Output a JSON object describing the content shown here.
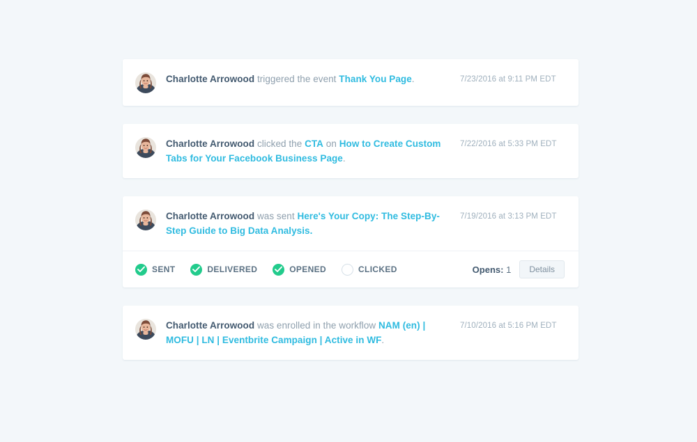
{
  "theme": {
    "page_background": "#f3f7fa",
    "card_background": "#ffffff",
    "name_color": "#42596f",
    "body_text_color": "#8e9fad",
    "link_color": "#2fbbe0",
    "timestamp_color": "#9fb0bd",
    "success_color": "#22cb8c",
    "empty_bullet_border": "#d6e0e8"
  },
  "avatar": {
    "alt": "Charlotte Arrowood profile photo",
    "icon": "user-avatar-photo"
  },
  "events": [
    {
      "id": "event-thank-you-page",
      "actor": "Charlotte Arrowood",
      "action": " triggered the event ",
      "link": "Thank You Page",
      "suffix": ".",
      "timestamp": "7/23/2016 at 9:11 PM EDT",
      "has_status_row": false
    },
    {
      "id": "event-cta-click",
      "actor": "Charlotte Arrowood",
      "action": " clicked the ",
      "link": "CTA",
      "action2": " on ",
      "link2": "How to Create Custom Tabs for Your Facebook Business Page",
      "suffix": ".",
      "timestamp": "7/22/2016 at 5:33 PM EDT",
      "has_status_row": false
    },
    {
      "id": "event-email-sent",
      "actor": "Charlotte Arrowood",
      "action": " was sent ",
      "link": "Here's Your Copy: The Step-By-Step Guide to Big Data Analysis.",
      "suffix": "",
      "timestamp": "7/19/2016 at 3:13 PM EDT",
      "has_status_row": true,
      "statuses": [
        {
          "label": "SENT",
          "complete": true,
          "icon": "check-circle-icon"
        },
        {
          "label": "DELIVERED",
          "complete": true,
          "icon": "check-circle-icon"
        },
        {
          "label": "OPENED",
          "complete": true,
          "icon": "check-circle-icon"
        },
        {
          "label": "CLICKED",
          "complete": false,
          "icon": "empty-circle-icon"
        }
      ],
      "opens_label": "Opens:",
      "opens_count": "1",
      "details_label": "Details"
    },
    {
      "id": "event-workflow-enrollment",
      "actor": "Charlotte Arrowood",
      "action": " was enrolled in the workflow ",
      "link": "NAM (en) | MOFU | LN | Eventbrite Campaign | Active in WF",
      "suffix": ".",
      "timestamp": "7/10/2016 at 5:16 PM EDT",
      "has_status_row": false
    }
  ]
}
